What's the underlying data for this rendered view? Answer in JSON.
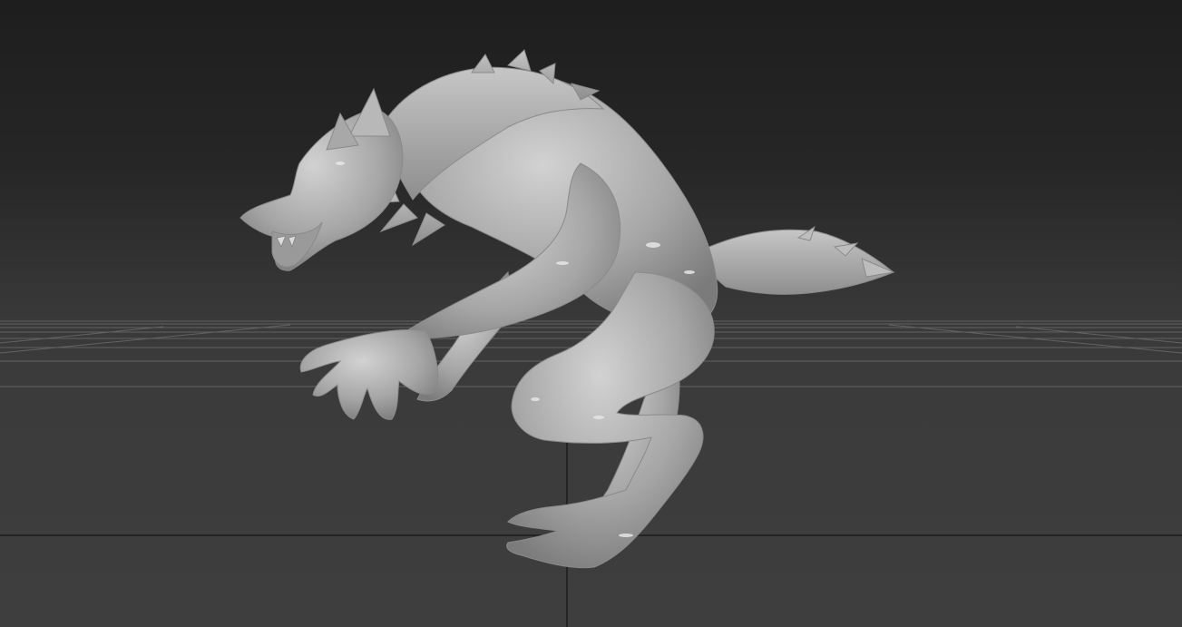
{
  "viewport": {
    "label": "",
    "background_top": "#1e1e1e",
    "background_bottom": "#3e3e3e",
    "grid_color": "#6a6a6a",
    "axis_color": "#141414",
    "model_color": "#a9a9a9",
    "model": "werewolf-sculpt"
  }
}
